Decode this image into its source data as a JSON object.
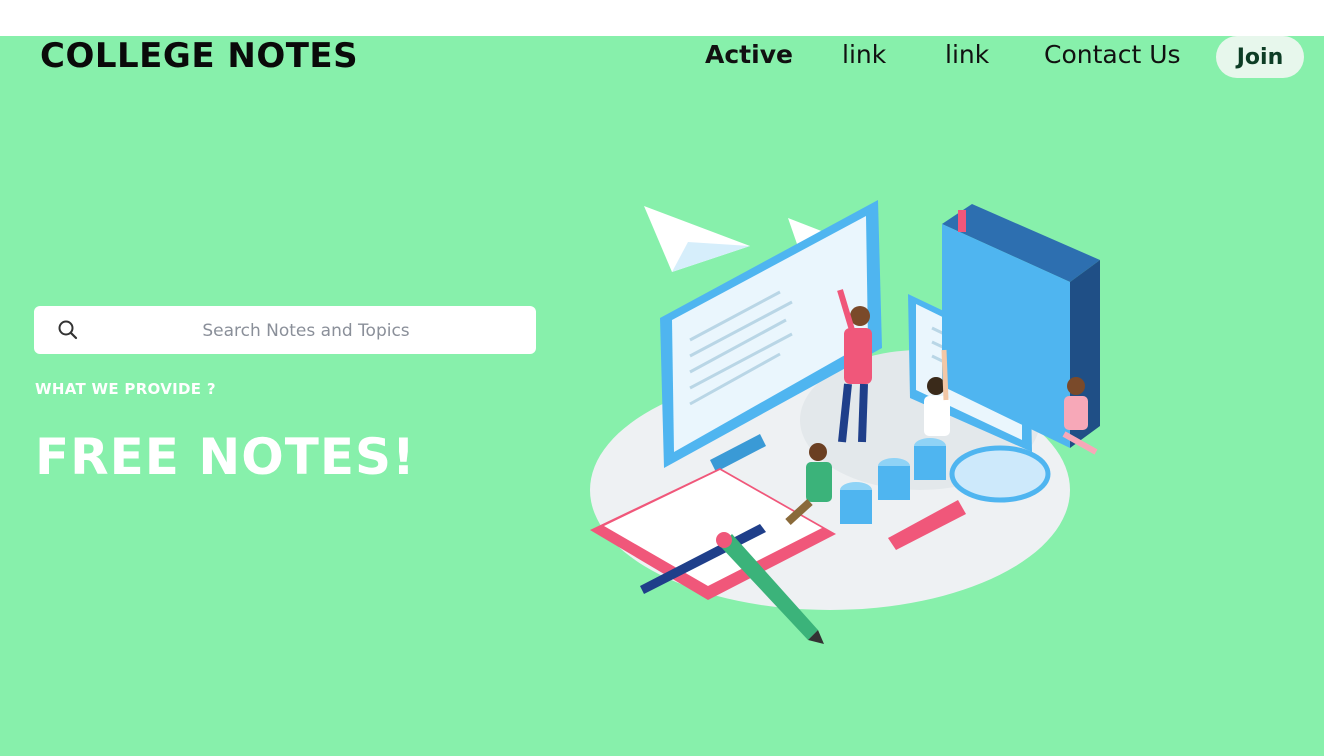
{
  "header": {
    "brand": "COLLEGE NOTES",
    "nav": [
      {
        "label": "Active",
        "active": true
      },
      {
        "label": "link",
        "active": false
      },
      {
        "label": "link",
        "active": false
      },
      {
        "label": "Contact Us",
        "active": false
      }
    ],
    "join_label": "Join"
  },
  "search": {
    "placeholder": "Search Notes and Topics",
    "icon": "search-icon"
  },
  "hero": {
    "kicker": "WHAT WE PROVIDE ?",
    "title": "FREE NOTES!"
  },
  "illustration": {
    "icon": "study-illustration"
  },
  "colors": {
    "background": "#87f0ab",
    "join_button": "#e7f7ec",
    "hero_text": "#ffffff",
    "accent_blue": "#4fb5f0",
    "accent_pink": "#f0577a"
  }
}
